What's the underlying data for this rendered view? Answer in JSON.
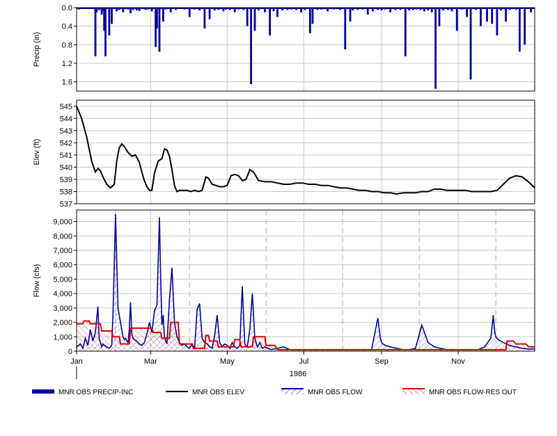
{
  "chart_data": {
    "type": "line",
    "x_axis": {
      "tick_labels": [
        "Jan",
        "Mar",
        "May",
        "Jul",
        "Sep",
        "Nov"
      ],
      "tick_days": [
        0,
        59,
        120,
        181,
        243,
        304
      ],
      "year_label": "1986",
      "range_days": [
        0,
        365
      ]
    },
    "panels": [
      {
        "id": "precip",
        "ylabel": "Precip (in)",
        "ylim": [
          0,
          1.8
        ],
        "reversed": true,
        "ticks": [
          "0.0",
          "0.4",
          "0.8",
          "1.2",
          "1.6"
        ],
        "tick_values": [
          0,
          0.4,
          0.8,
          1.2,
          1.6
        ],
        "series": [
          {
            "name": "MNR OBS PRECIP-INC",
            "type": "bar",
            "color": "#0000a0",
            "days": [
              2,
              7,
              10,
              15,
              16,
              18,
              20,
              21,
              22,
              23,
              26,
              28,
              32,
              34,
              37,
              41,
              43,
              45,
              48,
              50,
              52,
              55,
              57,
              60,
              63,
              64,
              66,
              69,
              71,
              75,
              79,
              82,
              86,
              90,
              94,
              98,
              102,
              106,
              110,
              113,
              117,
              119,
              122,
              126,
              129,
              133,
              136,
              139,
              142,
              145,
              150,
              154,
              157,
              160,
              164,
              168,
              171,
              175,
              179,
              182,
              186,
              188,
              192,
              195,
              200,
              205,
              210,
              214,
              218,
              220,
              224,
              228,
              232,
              236,
              240,
              243,
              246,
              250,
              254,
              258,
              262,
              265,
              268,
              271,
              274,
              277,
              280,
              283,
              286,
              289,
              292,
              296,
              299,
              303,
              307,
              311,
              314,
              318,
              322,
              327,
              331,
              335,
              338,
              342,
              345,
              350,
              353,
              357,
              362
            ],
            "values": [
              0.04,
              0.02,
              0.03,
              1.05,
              0.1,
              0.05,
              0.15,
              0.07,
              0.5,
              1.05,
              0.6,
              0.35,
              0.08,
              0.05,
              0.1,
              0.04,
              0.12,
              0.05,
              0.06,
              0.07,
              0.03,
              0.05,
              0.04,
              0.08,
              0.85,
              0.45,
              0.95,
              0.3,
              0.04,
              0.1,
              0.05,
              0.03,
              0.04,
              0.2,
              0.04,
              0.06,
              0.45,
              0.25,
              0.06,
              0.05,
              0.08,
              0.04,
              0.05,
              0.1,
              0.04,
              0.05,
              0.4,
              1.65,
              0.5,
              0.06,
              0.1,
              0.6,
              0.08,
              0.2,
              0.06,
              0.05,
              0.04,
              0.05,
              0.1,
              0.05,
              0.55,
              0.35,
              0.05,
              0.04,
              0.08,
              0.04,
              0.05,
              0.9,
              0.3,
              0.06,
              0.05,
              0.04,
              0.15,
              0.08,
              0.05,
              0.06,
              0.04,
              0.1,
              0.05,
              0.05,
              1.05,
              0.06,
              0.05,
              0.04,
              0.05,
              0.08,
              0.06,
              0.1,
              1.75,
              0.4,
              0.06,
              0.05,
              0.08,
              0.5,
              0.04,
              0.2,
              1.55,
              0.05,
              0.4,
              0.3,
              0.35,
              0.6,
              0.06,
              0.3,
              0.05,
              0.04,
              0.95,
              0.8,
              0.1,
              0.06,
              0.04,
              0.2,
              0.06,
              0.05,
              0.15,
              0.05,
              0.08,
              0.7,
              0.03,
              0.04,
              0.04
            ]
          }
        ]
      },
      {
        "id": "elev",
        "ylabel": "Elev (ft)",
        "ylim": [
          537,
          545.5
        ],
        "ticks": [
          "537",
          "538",
          "539",
          "540",
          "541",
          "542",
          "543",
          "544",
          "545"
        ],
        "tick_values": [
          537,
          538,
          539,
          540,
          541,
          542,
          543,
          544,
          545
        ],
        "series": [
          {
            "name": "MNR OBS ELEV",
            "type": "line",
            "color": "#000000",
            "x": [
              0,
              4,
              8,
              12,
              15,
              17,
              19,
              21,
              24,
              27,
              30,
              32,
              34,
              36,
              38,
              41,
              44,
              47,
              50,
              52,
              54,
              56,
              58,
              60,
              62,
              65,
              68,
              70,
              72,
              74,
              76,
              78,
              80,
              82,
              85,
              88,
              91,
              94,
              97,
              100,
              103,
              105,
              108,
              111,
              114,
              117,
              120,
              123,
              126,
              129,
              132,
              135,
              138,
              141,
              145,
              150,
              155,
              160,
              165,
              170,
              175,
              180,
              185,
              190,
              195,
              200,
              205,
              210,
              215,
              220,
              225,
              230,
              235,
              240,
              245,
              250,
              255,
              260,
              265,
              270,
              275,
              280,
              285,
              290,
              295,
              300,
              305,
              310,
              315,
              320,
              325,
              330,
              335,
              340,
              345,
              350,
              355,
              360,
              365
            ],
            "y": [
              545.0,
              544.0,
              542.5,
              540.5,
              539.6,
              539.9,
              539.7,
              539.2,
              538.6,
              538.3,
              538.6,
              540.5,
              541.6,
              541.9,
              541.7,
              541.2,
              540.9,
              541.0,
              540.4,
              539.6,
              538.9,
              538.4,
              538.1,
              538.1,
              539.5,
              540.5,
              540.7,
              541.5,
              541.4,
              540.9,
              539.8,
              538.5,
              538.0,
              538.1,
              538.1,
              538.1,
              538.0,
              538.1,
              538.0,
              538.1,
              539.2,
              539.1,
              538.6,
              538.5,
              538.4,
              538.4,
              538.5,
              539.3,
              539.4,
              539.3,
              538.9,
              539.0,
              539.8,
              539.6,
              538.9,
              538.8,
              538.8,
              538.7,
              538.6,
              538.6,
              538.7,
              538.7,
              538.6,
              538.6,
              538.5,
              538.5,
              538.4,
              538.3,
              538.3,
              538.2,
              538.1,
              538.1,
              538.0,
              538.0,
              537.9,
              537.9,
              537.8,
              537.9,
              537.9,
              537.9,
              538.0,
              538.0,
              538.2,
              538.2,
              538.1,
              538.1,
              538.1,
              538.1,
              538.0,
              538.0,
              538.0,
              538.0,
              538.1,
              538.6,
              539.1,
              539.3,
              539.2,
              538.8,
              538.3,
              538.2
            ]
          }
        ]
      },
      {
        "id": "flow",
        "ylabel": "Flow (cfs)",
        "ylim": [
          0,
          9800
        ],
        "ticks": [
          "0",
          "1,000",
          "2,000",
          "3,000",
          "4,000",
          "5,000",
          "6,000",
          "7,000",
          "8,000",
          "9,000"
        ],
        "tick_values": [
          0,
          1000,
          2000,
          3000,
          4000,
          5000,
          6000,
          7000,
          8000,
          9000
        ],
        "series": [
          {
            "name": "MNR OBS FLOW",
            "type": "area",
            "color": "#0000a0",
            "x": [
              0,
              3,
              5,
              7,
              9,
              11,
              13,
              15,
              17,
              18,
              19,
              20,
              21,
              22,
              24,
              26,
              28,
              29,
              30,
              31,
              33,
              35,
              36,
              37,
              38,
              39,
              40,
              41,
              42,
              43,
              44,
              45,
              46,
              48,
              50,
              52,
              54,
              56,
              58,
              60,
              62,
              64,
              66,
              67,
              68,
              69,
              70,
              71,
              72,
              74,
              76,
              78,
              80,
              82,
              84,
              86,
              88,
              90,
              92,
              94,
              96,
              98,
              100,
              102,
              104,
              106,
              108,
              110,
              112,
              114,
              116,
              118,
              120,
              122,
              124,
              126,
              128,
              130,
              132,
              134,
              136,
              138,
              140,
              142,
              144,
              146,
              148,
              150,
              155,
              160,
              165,
              170,
              175,
              180,
              185,
              190,
              195,
              200,
              205,
              210,
              215,
              220,
              225,
              230,
              235,
              240,
              242,
              243,
              244,
              246,
              250,
              255,
              260,
              265,
              270,
              275,
              280,
              285,
              290,
              295,
              300,
              305,
              310,
              315,
              320,
              325,
              330,
              332,
              333,
              334,
              336,
              340,
              345,
              350,
              355,
              360,
              365
            ],
            "y": [
              300,
              500,
              200,
              900,
              400,
              1500,
              700,
              1300,
              3100,
              900,
              600,
              300,
              500,
              400,
              300,
              200,
              400,
              2600,
              6000,
              9500,
              3000,
              2000,
              1500,
              1000,
              800,
              900,
              700,
              600,
              1500,
              3400,
              1200,
              900,
              800,
              700,
              500,
              400,
              600,
              1200,
              2000,
              1300,
              2800,
              3200,
              9300,
              5000,
              1800,
              2500,
              1000,
              700,
              500,
              3600,
              5800,
              2000,
              1000,
              600,
              400,
              500,
              300,
              200,
              500,
              200,
              2900,
              3300,
              900,
              600,
              500,
              300,
              200,
              1100,
              2500,
              600,
              300,
              500,
              400,
              200,
              600,
              300,
              200,
              400,
              4500,
              500,
              300,
              1500,
              4000,
              900,
              300,
              600,
              200,
              300,
              100,
              200,
              300,
              100,
              100,
              100,
              100,
              100,
              100,
              100,
              100,
              100,
              100,
              100,
              100,
              100,
              100,
              2300,
              900,
              600,
              500,
              400,
              300,
              200,
              100,
              100,
              200,
              1800,
              600,
              300,
              200,
              100,
              100,
              100,
              100,
              100,
              100,
              300,
              900,
              2500,
              1400,
              1000,
              800,
              600,
              400,
              300,
              200,
              150,
              150
            ]
          },
          {
            "name": "MNR OBS FLOW-RES OUT",
            "type": "area",
            "color": "#e00000",
            "x": [
              0,
              5,
              6,
              10,
              11,
              19,
              20,
              28,
              29,
              34,
              35,
              42,
              43,
              60,
              61,
              67,
              68,
              74,
              75,
              81,
              82,
              92,
              93,
              102,
              103,
              105,
              106,
              112,
              113,
              125,
              126,
              130,
              131,
              140,
              141,
              150,
              151,
              158,
              160,
              220,
              300,
              342,
              343,
              348,
              350,
              358,
              360,
              365
            ],
            "y": [
              1900,
              1900,
              2100,
              2100,
              1900,
              1900,
              1400,
              1400,
              1000,
              1000,
              500,
              500,
              1600,
              1600,
              1300,
              1300,
              900,
              900,
              2000,
              2000,
              500,
              500,
              200,
              200,
              1100,
              1100,
              700,
              700,
              300,
              300,
              800,
              800,
              300,
              300,
              1000,
              1000,
              400,
              400,
              100,
              100,
              100,
              100,
              700,
              700,
              500,
              500,
              300,
              300
            ]
          }
        ]
      }
    ],
    "legend": [
      {
        "label": "MNR OBS PRECIP-INC",
        "style": "thick-line",
        "color": "#0000a0"
      },
      {
        "label": "MNR OBS ELEV",
        "style": "line",
        "color": "#000000"
      },
      {
        "label": "MNR OBS FLOW",
        "style": "hatched",
        "color": "#0000a0"
      },
      {
        "label": "MNR OBS FLOW-RES OUT",
        "style": "hatched",
        "color": "#e00000"
      }
    ],
    "legend_position": "bottom",
    "grid": true
  }
}
